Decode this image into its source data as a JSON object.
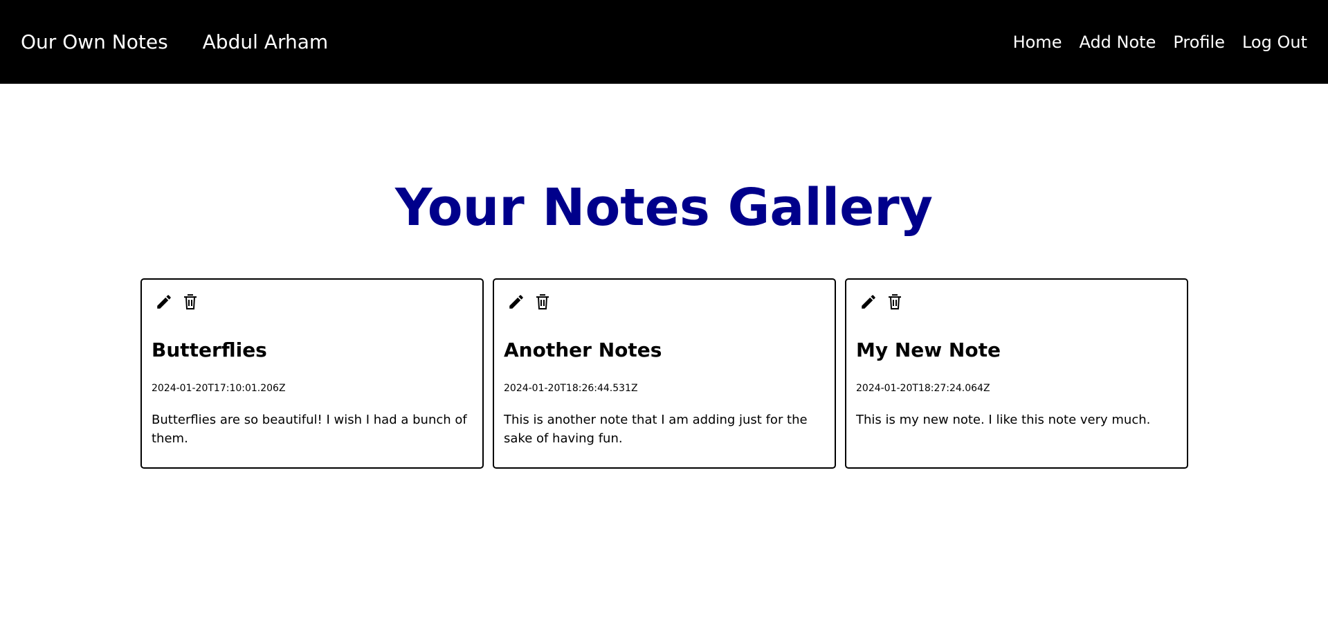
{
  "nav": {
    "brand": "Our Own Notes",
    "username": "Abdul Arham",
    "links": [
      "Home",
      "Add Note",
      "Profile",
      "Log Out"
    ]
  },
  "page_title": "Your Notes Gallery",
  "notes": [
    {
      "title": "Butterflies",
      "date": "2024-01-20T17:10:01.206Z",
      "body": "Butterflies are so beautiful! I wish I had a bunch of them."
    },
    {
      "title": "Another Notes",
      "date": "2024-01-20T18:26:44.531Z",
      "body": "This is another note that I am adding just for the sake of having fun."
    },
    {
      "title": "My New Note",
      "date": "2024-01-20T18:27:24.064Z",
      "body": "This is my new note. I like this note very much."
    }
  ],
  "icons": {
    "edit": "pencil-icon",
    "delete": "trash-icon"
  },
  "colors": {
    "navbar_bg": "#000000",
    "title_color": "#00008b",
    "card_border": "#000000"
  }
}
